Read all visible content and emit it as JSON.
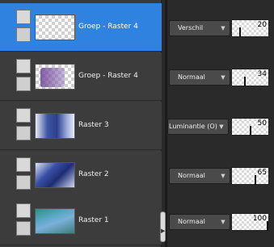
{
  "layers": [
    {
      "name": "Groep - Raster 4",
      "blend": "Verschil",
      "opacity": "20",
      "opacity_fraction": 0.2,
      "selected": true
    },
    {
      "name": "Groep - Raster 4",
      "blend": "Normaal",
      "opacity": "34",
      "opacity_fraction": 0.34,
      "selected": false
    },
    {
      "name": "Raster 3",
      "blend": "Luminantie (O)",
      "opacity": "50",
      "opacity_fraction": 0.5,
      "selected": false
    },
    {
      "name": "Raster 2",
      "blend": "Normaal",
      "opacity": "65",
      "opacity_fraction": 0.65,
      "selected": false
    },
    {
      "name": "Raster 1",
      "blend": "Normaal",
      "opacity": "100",
      "opacity_fraction": 1.0,
      "selected": false
    }
  ],
  "icons": {
    "dropdown": "chevron-down-icon",
    "visibility": "eye-icon",
    "layer_type": "page-icon"
  },
  "colors": {
    "selected_row": "#2f82e0",
    "panel_bg": "#3c3c3c"
  }
}
